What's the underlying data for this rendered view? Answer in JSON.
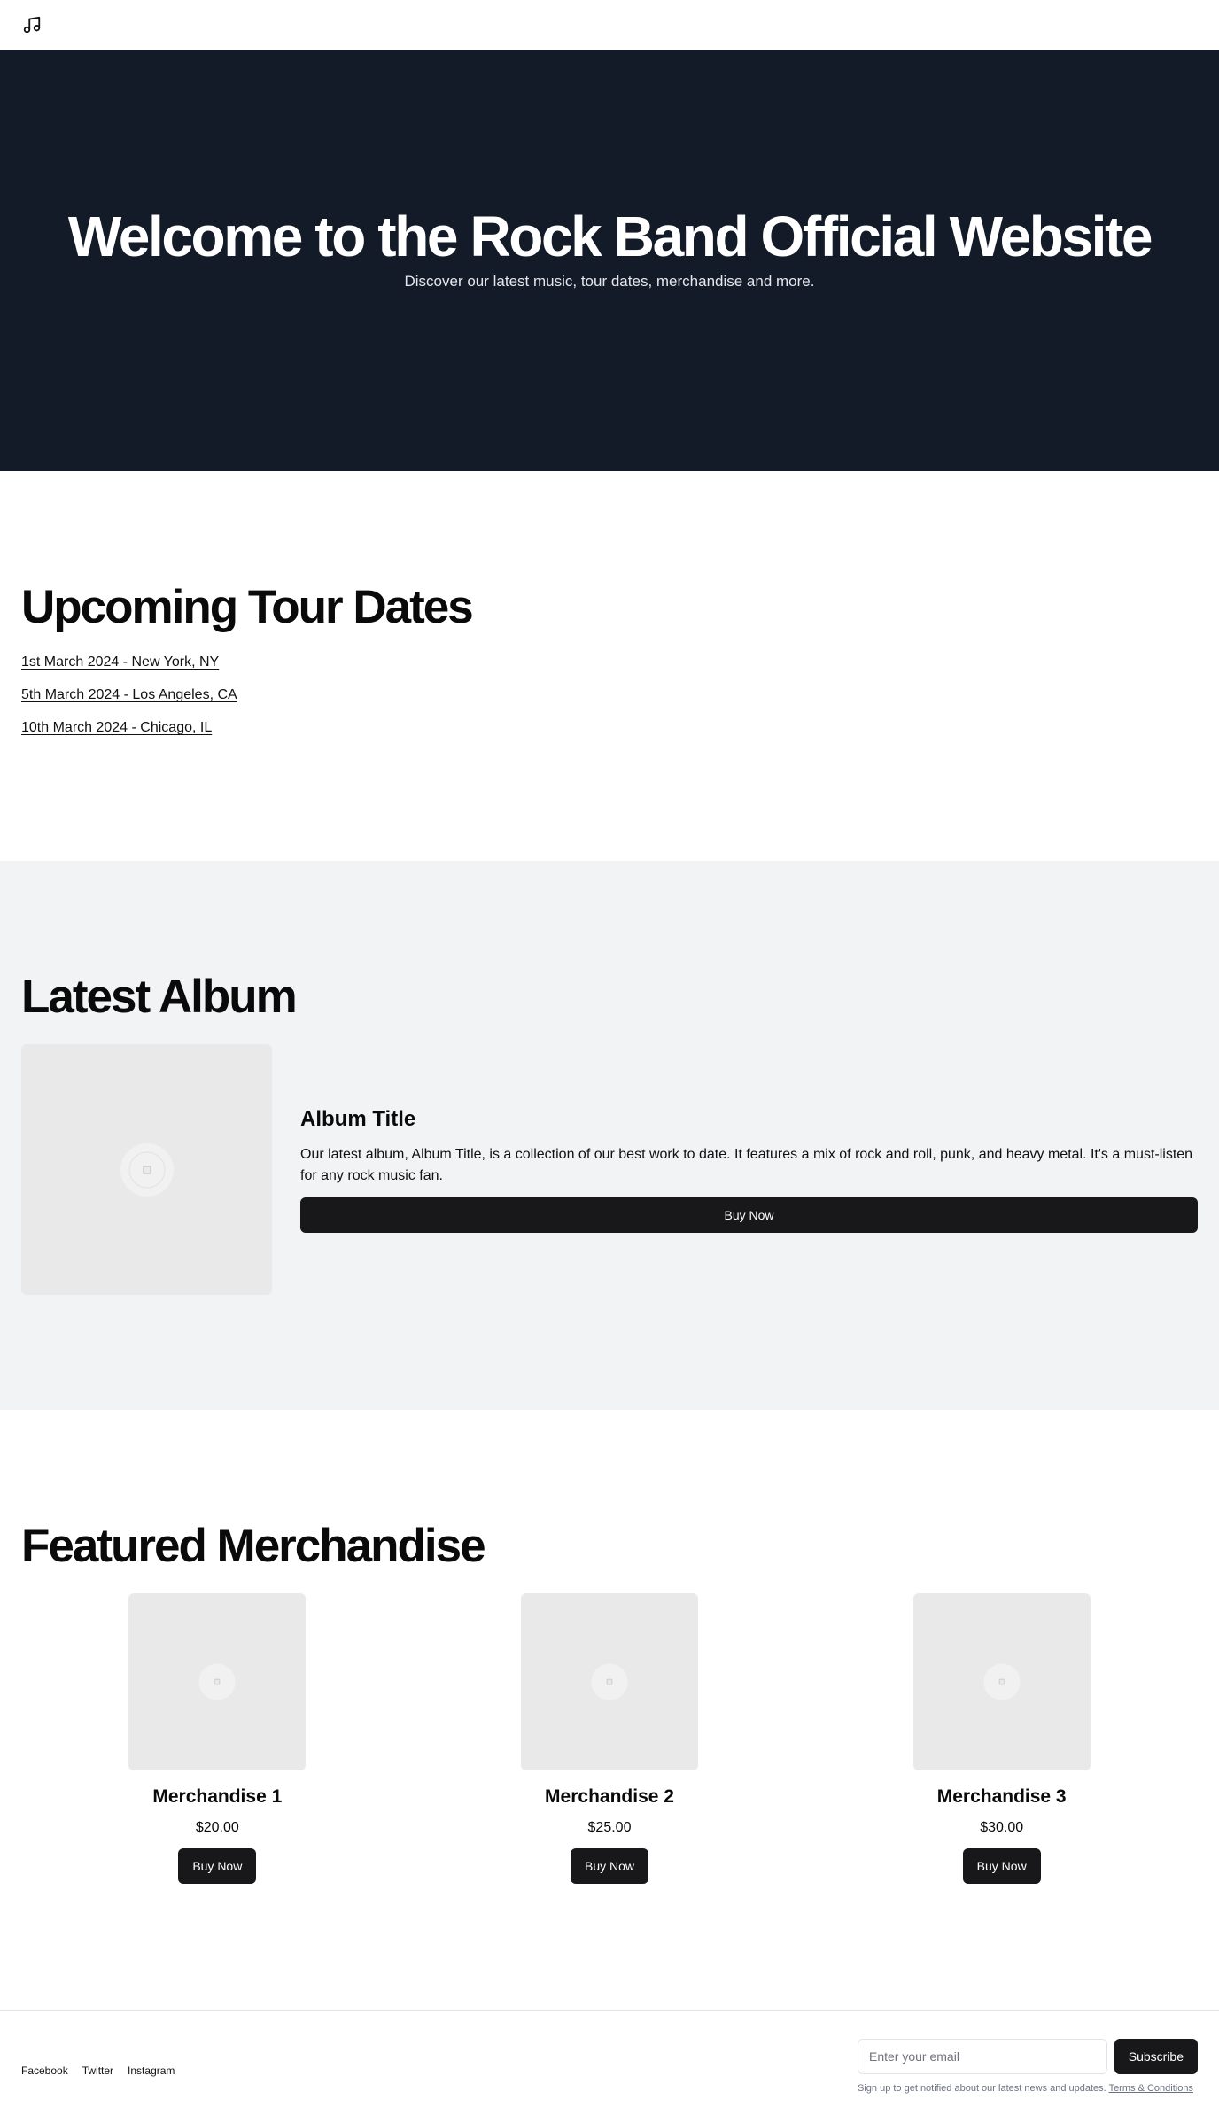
{
  "header": {
    "logo_icon": "music-note-icon"
  },
  "hero": {
    "title": "Welcome to the Rock Band Official Website",
    "subtitle": "Discover our latest music, tour dates, merchandise and more."
  },
  "tour": {
    "title": "Upcoming Tour Dates",
    "dates": [
      "1st March 2024 - New York, NY",
      "5th March 2024 - Los Angeles, CA",
      "10th March 2024 - Chicago, IL"
    ]
  },
  "album": {
    "section_title": "Latest Album",
    "cover_icon": "image-placeholder-icon",
    "title": "Album Title",
    "description": "Our latest album, Album Title, is a collection of our best work to date. It features a mix of rock and roll, punk, and heavy metal. It's a must-listen for any rock music fan.",
    "buy_label": "Buy Now"
  },
  "merch": {
    "title": "Featured Merchandise",
    "items": [
      {
        "name": "Merchandise 1",
        "price": "$20.00",
        "buy_label": "Buy Now"
      },
      {
        "name": "Merchandise 2",
        "price": "$25.00",
        "buy_label": "Buy Now"
      },
      {
        "name": "Merchandise 3",
        "price": "$30.00",
        "buy_label": "Buy Now"
      }
    ]
  },
  "footer": {
    "links": [
      "Facebook",
      "Twitter",
      "Instagram"
    ],
    "email_placeholder": "Enter your email",
    "subscribe_label": "Subscribe",
    "note": "Sign up to get notified about our latest news and updates.",
    "terms_label": "Terms & Conditions"
  },
  "colors": {
    "hero_bg": "#131a28",
    "album_bg": "#f2f3f5",
    "button_bg": "#18181b"
  }
}
